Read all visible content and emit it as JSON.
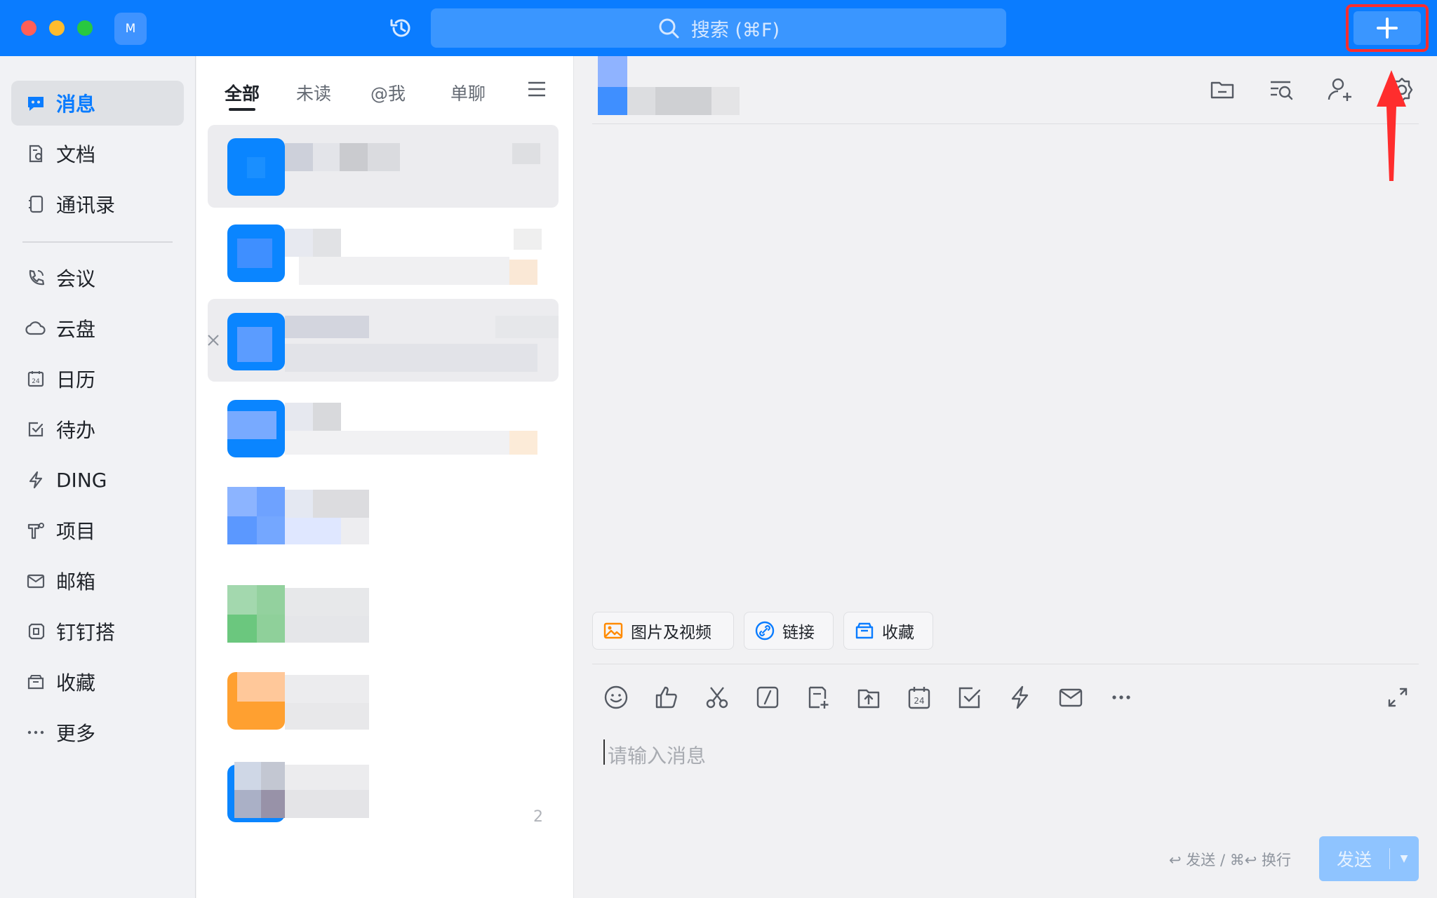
{
  "window": {
    "avatar_letter": "M",
    "search_placeholder": "搜索 (⌘F)",
    "accent": "#0a7cff"
  },
  "nav": {
    "items": [
      {
        "label": "消息",
        "icon": "message-icon",
        "active": true
      },
      {
        "label": "文档",
        "icon": "document-icon"
      },
      {
        "label": "通讯录",
        "icon": "contacts-icon"
      },
      {
        "label": "会议",
        "icon": "meeting-icon"
      },
      {
        "label": "云盘",
        "icon": "cloud-icon"
      },
      {
        "label": "日历",
        "icon": "calendar-icon"
      },
      {
        "label": "待办",
        "icon": "todo-icon"
      },
      {
        "label": "DING",
        "icon": "ding-icon"
      },
      {
        "label": "项目",
        "icon": "project-icon"
      },
      {
        "label": "邮箱",
        "icon": "mail-icon"
      },
      {
        "label": "钉钉搭",
        "icon": "dingda-icon"
      },
      {
        "label": "收藏",
        "icon": "favorite-icon"
      },
      {
        "label": "更多",
        "icon": "more-icon"
      }
    ]
  },
  "conversation_list": {
    "tabs": [
      "全部",
      "未读",
      "@我",
      "单聊"
    ],
    "active_tab": "全部",
    "last_item_count": "2"
  },
  "chat": {
    "quick_actions": [
      "图片及视频",
      "链接",
      "收藏"
    ],
    "input_placeholder": "请输入消息",
    "send_hint": "↩ 发送 / ⌘↩ 换行",
    "send_label": "发送"
  }
}
